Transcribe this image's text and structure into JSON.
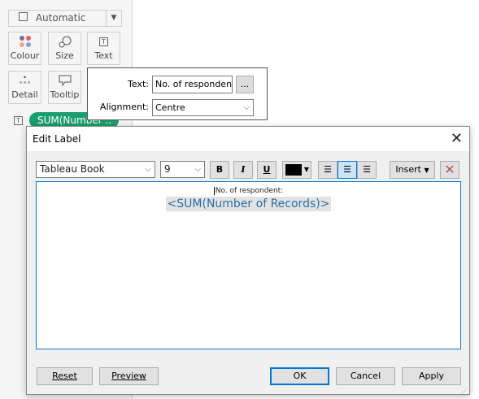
{
  "marks": {
    "type": "Automatic",
    "cards": [
      {
        "label": "Colour",
        "icon": "colour-dots-icon"
      },
      {
        "label": "Size",
        "icon": "size-icon"
      },
      {
        "label": "Text",
        "icon": "text-icon"
      },
      {
        "label": "Detail",
        "icon": "detail-icon"
      },
      {
        "label": "Tooltip",
        "icon": "tooltip-icon"
      }
    ],
    "pill": "SUM(Number ..",
    "pill_color": "#1a9e6e"
  },
  "popup": {
    "text_label": "Text:",
    "text_value": "No. of respondent:",
    "ellipsis": "...",
    "align_label": "Alignment:",
    "align_value": "Centre"
  },
  "dialog": {
    "title": "Edit Label",
    "font": "Tableau Book",
    "size": "9",
    "bold": "B",
    "italic": "I",
    "underline": "U",
    "insert": "Insert",
    "line1": "No. of respondent:",
    "line2": "<SUM(Number of Records)>",
    "field_color": "#2a6ea8",
    "reset": "Reset",
    "preview": "Preview",
    "ok": "OK",
    "cancel": "Cancel",
    "apply": "Apply"
  }
}
